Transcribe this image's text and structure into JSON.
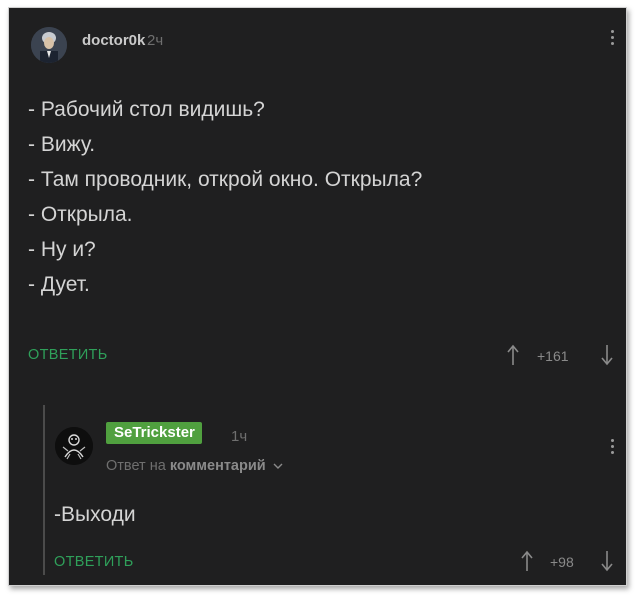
{
  "post": {
    "author": "doctor0k",
    "time": "2ч",
    "lines": [
      "- Рабочий стол видишь?",
      "- Вижу.",
      "- Там проводник, открой окно. Открыла?",
      "- Открыла.",
      "- Ну и?",
      "- Дует."
    ],
    "reply_label": "ОТВЕТИТЬ",
    "rating": "+161"
  },
  "reply": {
    "author": "SeTrickster",
    "time": "1ч",
    "reply_to_prefix": "Ответ на",
    "reply_to_link": "комментарий",
    "text": "-Выходи",
    "reply_label": "ОТВЕТИТЬ",
    "rating": "+98"
  },
  "colors": {
    "background": "#1f1f20",
    "accent_green": "#2fa05a",
    "badge_green": "#50a03f",
    "text": "#d4d4d4",
    "muted": "#6f6f6f"
  },
  "icons": [
    "avatar-icon",
    "more-vertical-icon",
    "upvote-arrow-icon",
    "downvote-arrow-icon",
    "chevron-down-icon"
  ]
}
